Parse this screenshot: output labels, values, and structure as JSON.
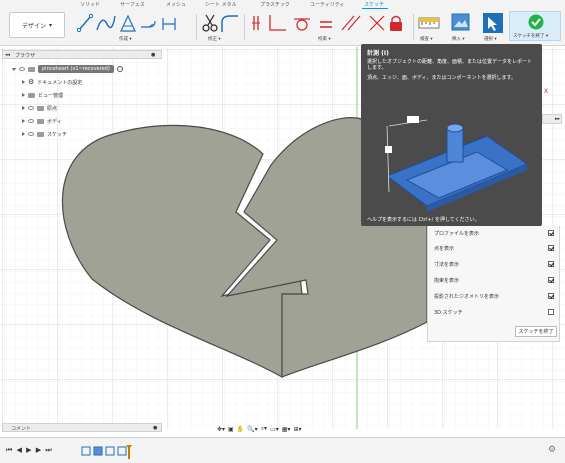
{
  "tabs": [
    {
      "label": "ソリッド"
    },
    {
      "label": "サーフェス"
    },
    {
      "label": "メッシュ"
    },
    {
      "label": "シート メタル"
    },
    {
      "label": "プラスチック"
    },
    {
      "label": "ユーティリティ"
    },
    {
      "label": "スケッチ"
    }
  ],
  "toolbar": {
    "design_label": "デザイン",
    "groups": {
      "create": "作成",
      "modify": "修正",
      "constraints": "拘束",
      "inspect": "検査",
      "insert": "挿入",
      "select": "選択",
      "finish": "スケッチを終了"
    }
  },
  "browser": {
    "title": "ブラウザ",
    "root": "pinceheart (v1~recovered)",
    "items": [
      {
        "label": "ドキュメントの設定"
      },
      {
        "label": "ビュー管理"
      },
      {
        "label": "原点"
      },
      {
        "label": "ボディ"
      },
      {
        "label": "スケッチ"
      }
    ]
  },
  "tooltip": {
    "title": "計測 (I)",
    "line1": "選択したオブジェクトの距離、角度、面積、または位置データをレポートします。",
    "line2": "頂点、エッジ、面、ボディ、またはコンポーネントを選択します。",
    "footer": "ヘルプを表示するには Ctrl+/ を押してください。"
  },
  "palette": {
    "rows": [
      {
        "label": "プロファイルを表示",
        "checked": true
      },
      {
        "label": "点を表示",
        "checked": true
      },
      {
        "label": "寸法を表示",
        "checked": true
      },
      {
        "label": "拘束を表示",
        "checked": true
      },
      {
        "label": "投影されたジオメトリを表示",
        "checked": true
      },
      {
        "label": "3D スケッチ",
        "checked": false
      }
    ],
    "finish_label": "スケッチを終了"
  },
  "comments": {
    "label": "コメント"
  },
  "colors": {
    "accent": "#0696d7",
    "heart_fill": "#a0a296",
    "finish_green": "#24b24b"
  }
}
